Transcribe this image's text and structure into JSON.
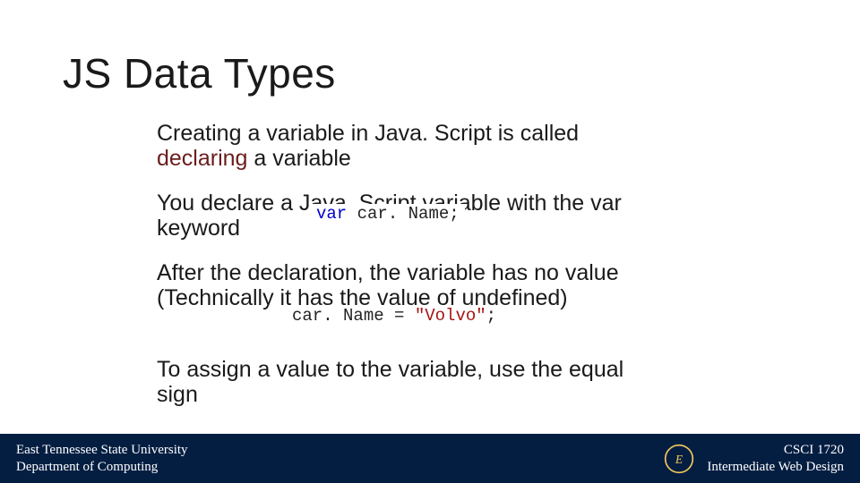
{
  "title": "JS Data Types",
  "paras": {
    "p1a": "Creating a variable in Java. Script is called ",
    "p1b": "declaring",
    "p1c": " a variable",
    "p2": "You declare a Java. Script variable with the var keyword",
    "p3": "After the declaration, the variable has no value (Technically it has the value of undefined)",
    "p4": "To assign a value to the variable, use the equal sign"
  },
  "code1": {
    "kw": "var",
    "ident": "car. Name",
    "semi": ";"
  },
  "code2": {
    "ident": "car. Name",
    "eq": " = ",
    "str": "\"Volvo\"",
    "semi": ";"
  },
  "footer": {
    "left1": "East Tennessee State University",
    "left2": "Department of Computing",
    "right1": "CSCI 1720",
    "right2": "Intermediate Web Design"
  }
}
